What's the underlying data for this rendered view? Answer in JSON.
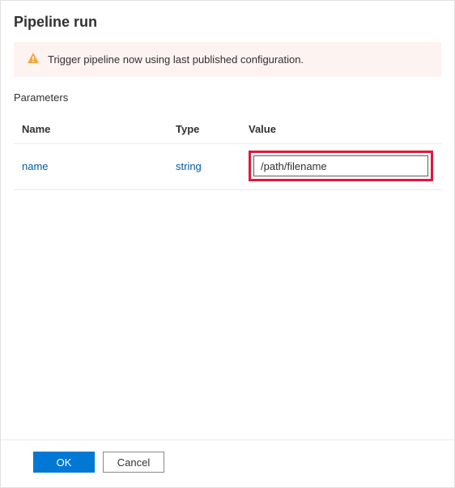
{
  "title": "Pipeline run",
  "alert": {
    "text": "Trigger pipeline now using last published configuration."
  },
  "parameters": {
    "label": "Parameters",
    "headers": {
      "name": "Name",
      "type": "Type",
      "value": "Value"
    },
    "rows": [
      {
        "name": "name",
        "type": "string",
        "value": "/path/filename"
      }
    ]
  },
  "footer": {
    "ok": "OK",
    "cancel": "Cancel"
  }
}
